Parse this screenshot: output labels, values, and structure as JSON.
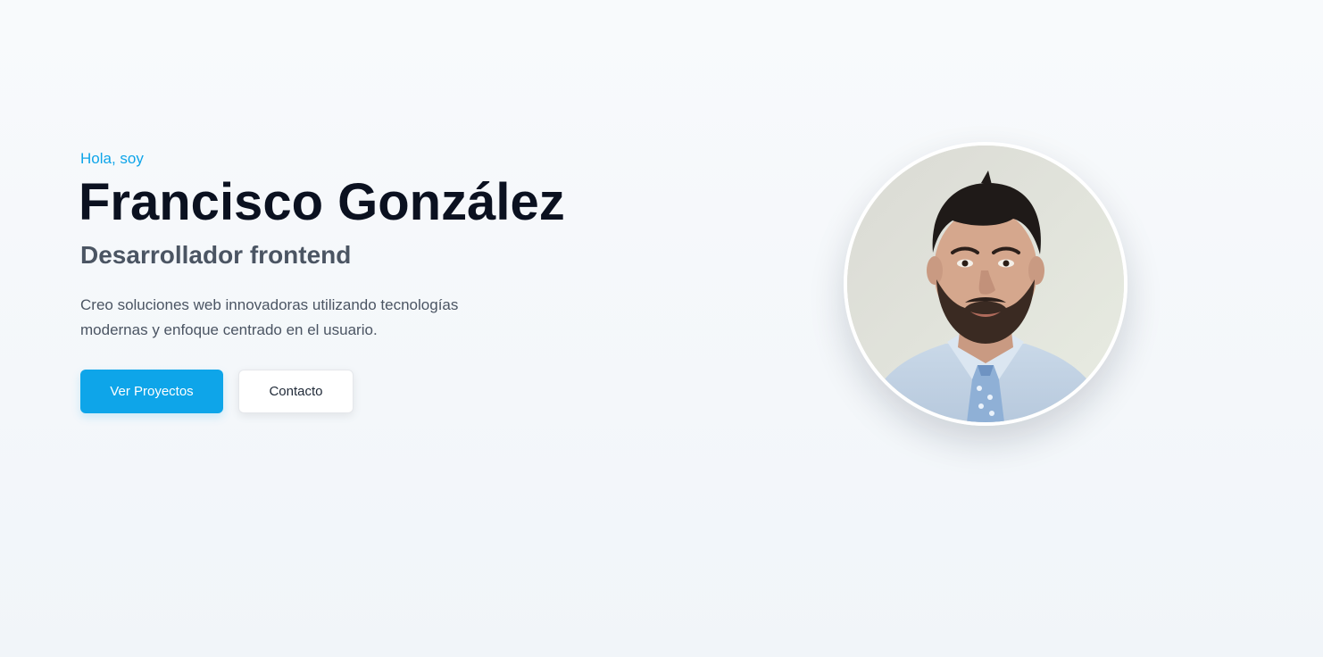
{
  "hero": {
    "greeting": "Hola, soy",
    "name": "Francisco González",
    "role": "Desarrollador frontend",
    "description": "Creo soluciones web innovadoras utilizando tecnologías modernas y enfoque centrado en el usuario.",
    "primary_button": "Ver Proyectos",
    "secondary_button": "Contacto"
  },
  "colors": {
    "accent": "#0ea5e9",
    "heading": "#0b1120",
    "text": "#4b5563"
  }
}
